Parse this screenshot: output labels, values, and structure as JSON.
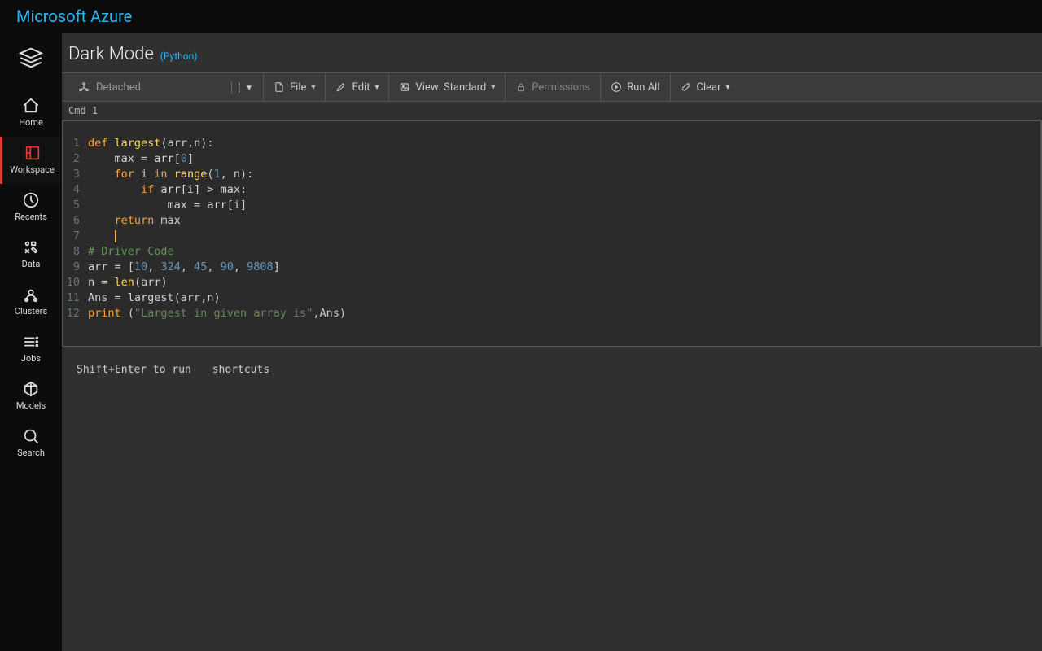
{
  "brand": "Microsoft Azure",
  "sidebar": {
    "items": [
      {
        "id": "home",
        "label": "Home"
      },
      {
        "id": "workspace",
        "label": "Workspace"
      },
      {
        "id": "recents",
        "label": "Recents"
      },
      {
        "id": "data",
        "label": "Data"
      },
      {
        "id": "clusters",
        "label": "Clusters"
      },
      {
        "id": "jobs",
        "label": "Jobs"
      },
      {
        "id": "models",
        "label": "Models"
      },
      {
        "id": "search",
        "label": "Search"
      }
    ],
    "active": "workspace"
  },
  "page": {
    "title": "Dark Mode",
    "lang": "(Python)"
  },
  "toolbar": {
    "cluster": "Detached",
    "file": "File",
    "edit": "Edit",
    "view": "View: Standard",
    "permissions": "Permissions",
    "run": "Run All",
    "clear": "Clear"
  },
  "cell": {
    "label": "Cmd 1"
  },
  "code": {
    "lines": 12,
    "tokens": [
      [
        [
          "def",
          "kw"
        ],
        [
          " ",
          "id"
        ],
        [
          "largest",
          "name2"
        ],
        [
          "(arr,n):",
          "punc"
        ]
      ],
      [
        [
          "    max ",
          "id"
        ],
        [
          "=",
          "punc"
        ],
        [
          " arr[",
          "id"
        ],
        [
          "0",
          "num"
        ],
        [
          "]",
          "punc"
        ]
      ],
      [
        [
          "    ",
          "id"
        ],
        [
          "for",
          "kw"
        ],
        [
          " i ",
          "id"
        ],
        [
          "in",
          "kw"
        ],
        [
          " ",
          "id"
        ],
        [
          "range",
          "name2"
        ],
        [
          "(",
          "punc"
        ],
        [
          "1",
          "num"
        ],
        [
          ", n):",
          "punc"
        ]
      ],
      [
        [
          "        ",
          "id"
        ],
        [
          "if",
          "kw"
        ],
        [
          " arr[i] > max:",
          "id"
        ]
      ],
      [
        [
          "            max ",
          "id"
        ],
        [
          "=",
          "punc"
        ],
        [
          " arr[i]",
          "id"
        ]
      ],
      [
        [
          "    ",
          "id"
        ],
        [
          "return",
          "kw"
        ],
        [
          " max",
          "id"
        ]
      ],
      [
        [
          "",
          "id"
        ]
      ],
      [
        [
          "# Driver Code",
          "cmt"
        ]
      ],
      [
        [
          "arr ",
          "id"
        ],
        [
          "=",
          "punc"
        ],
        [
          " [",
          "punc"
        ],
        [
          "10",
          "num"
        ],
        [
          ", ",
          "punc"
        ],
        [
          "324",
          "num"
        ],
        [
          ", ",
          "punc"
        ],
        [
          "45",
          "num"
        ],
        [
          ", ",
          "punc"
        ],
        [
          "90",
          "num"
        ],
        [
          ", ",
          "punc"
        ],
        [
          "9808",
          "num"
        ],
        [
          "]",
          "punc"
        ]
      ],
      [
        [
          "n ",
          "id"
        ],
        [
          "=",
          "punc"
        ],
        [
          " ",
          "id"
        ],
        [
          "len",
          "name2"
        ],
        [
          "(arr)",
          "punc"
        ]
      ],
      [
        [
          "Ans ",
          "id"
        ],
        [
          "=",
          "punc"
        ],
        [
          " largest(arr,n)",
          "id"
        ]
      ],
      [
        [
          "print",
          "kw"
        ],
        [
          " (",
          "punc"
        ],
        [
          "\"Largest in given array is\"",
          "str"
        ],
        [
          ",Ans)",
          "punc"
        ]
      ]
    ],
    "cursor_line": 7
  },
  "footer": {
    "hint": "Shift+Enter to run",
    "link": "shortcuts"
  }
}
